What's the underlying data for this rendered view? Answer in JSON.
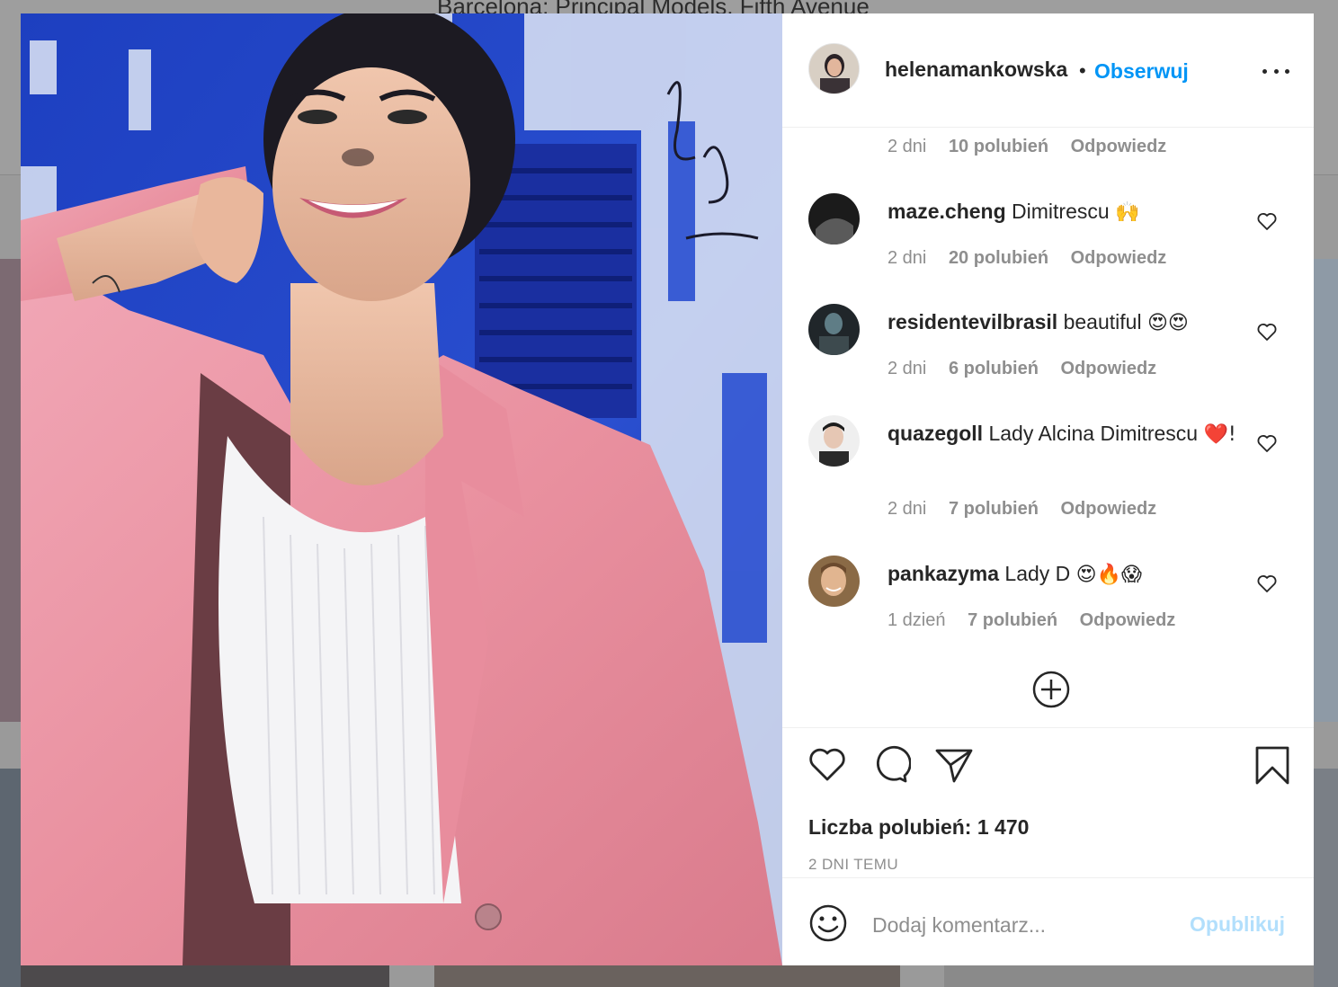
{
  "background": {
    "caption": "Barcelona: Principal Models, Fifth Avenue"
  },
  "post": {
    "image_alt": "smiling woman in pink blazer against blue door"
  },
  "header": {
    "username": "helenamankowska",
    "separator": "•",
    "follow_label": "Obserwuj"
  },
  "partial_comment": {
    "time": "2 dni",
    "likes": "10 polubień",
    "reply": "Odpowiedz"
  },
  "comments": [
    {
      "user": "maze.cheng",
      "text": "Dimitrescu",
      "emoji": "🙌",
      "time": "2 dni",
      "likes": "20 polubień",
      "reply": "Odpowiedz"
    },
    {
      "user": "residentevilbrasil",
      "text": "beautiful",
      "emoji": "😍😍",
      "time": "2 dni",
      "likes": "6 polubień",
      "reply": "Odpowiedz"
    },
    {
      "user": "quazegoll",
      "text": "Lady Alcina Dimitrescu",
      "emoji": "❤️!",
      "time": "2 dni",
      "likes": "7 polubień",
      "reply": "Odpowiedz"
    },
    {
      "user": "pankazyma",
      "text": "Lady D",
      "emoji": "😍🔥😱",
      "time": "1 dzień",
      "likes": "7 polubień",
      "reply": "Odpowiedz"
    }
  ],
  "actions": {
    "likes_label": "Liczba polubień:",
    "likes_count": "1 470",
    "time_ago": "2 DNI TEMU"
  },
  "add_comment": {
    "placeholder": "Dodaj komentarz...",
    "publish_label": "Opublikuj"
  },
  "icons": [
    "heart-icon",
    "comment-icon",
    "share-icon",
    "bookmark-icon",
    "more-icon",
    "plus-circle-icon",
    "emoji-icon"
  ],
  "colors": {
    "accent": "#0095f6",
    "publish_disabled": "#b2dffc",
    "text_secondary": "#8e8e8e"
  }
}
